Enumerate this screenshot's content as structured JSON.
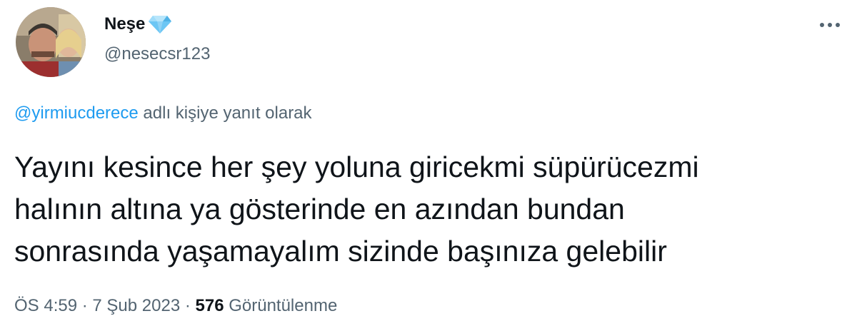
{
  "author": {
    "display_name": "Neşe",
    "handle": "@nesecsr123",
    "badge_icon": "diamond-icon",
    "avatar_icon": "profile-photo"
  },
  "more_icon": "more-options-icon",
  "reply_to": {
    "mention": "@yirmiucderece",
    "suffix": " adlı kişiye yanıt olarak"
  },
  "tweet": {
    "lines": [
      "Yayını kesince her şey yoluna giricekmi süpürücezmi",
      "halının altına ya gösterinde en azından bundan",
      "sonrasında yaşamayalım sizinde başınıza gelebilir"
    ]
  },
  "meta": {
    "time": "ÖS 4:59",
    "separator": " · ",
    "date": "7 Şub 2023",
    "views_count": "576",
    "views_label": " Görüntülenme"
  },
  "colors": {
    "text": "#0f1419",
    "secondary": "#536471",
    "link": "#1d9bf0",
    "badge": "#6cc6f4"
  }
}
